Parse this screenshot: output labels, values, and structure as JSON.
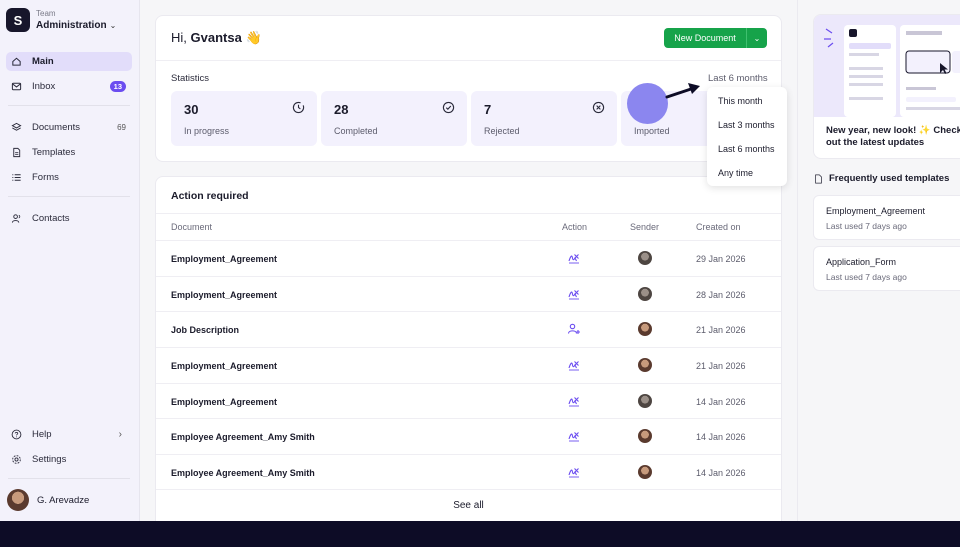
{
  "sidebar": {
    "team_label": "Team",
    "team_name": "Administration",
    "team_logo": "S",
    "items": [
      {
        "label": "Main",
        "icon": "home-icon"
      },
      {
        "label": "Inbox",
        "icon": "mail-icon",
        "badge": "13"
      },
      {
        "label": "Documents",
        "icon": "layers-icon",
        "count": "69"
      },
      {
        "label": "Templates",
        "icon": "file-icon"
      },
      {
        "label": "Forms",
        "icon": "list-icon"
      },
      {
        "label": "Contacts",
        "icon": "users-icon"
      }
    ],
    "help": "Help",
    "settings": "Settings",
    "user_name": "G. Arevadze"
  },
  "header": {
    "greeting": "Hi,",
    "name": "Gvantsa",
    "emoji": "👋",
    "new_document": "New Document"
  },
  "stats": {
    "title": "Statistics",
    "range": "Last 6 months",
    "cards": [
      {
        "value": "30",
        "label": "In progress",
        "icon": "clock-icon"
      },
      {
        "value": "28",
        "label": "Completed",
        "icon": "check-circle-icon"
      },
      {
        "value": "7",
        "label": "Rejected",
        "icon": "x-circle-icon"
      },
      {
        "value": "",
        "label": "Imported",
        "icon": "import-icon"
      }
    ],
    "dropdown": [
      "This month",
      "Last 3 months",
      "Last 6 months",
      "Any time"
    ]
  },
  "actions": {
    "title": "Action required",
    "columns": [
      "Document",
      "Action",
      "Sender",
      "Created on"
    ],
    "rows": [
      {
        "document": "Employment_Agreement",
        "action": "sign-icon",
        "date": "29 Jan 2026"
      },
      {
        "document": "Employment_Agreement",
        "action": "sign-icon",
        "date": "28 Jan 2026"
      },
      {
        "document": "Job Description",
        "action": "assign-user-icon",
        "date": "21 Jan 2026"
      },
      {
        "document": "Employment_Agreement",
        "action": "sign-icon",
        "date": "21 Jan 2026"
      },
      {
        "document": "Employment_Agreement",
        "action": "sign-icon",
        "date": "14 Jan 2026"
      },
      {
        "document": "Employee Agreement_Amy Smith",
        "action": "sign-icon",
        "date": "14 Jan 2026"
      },
      {
        "document": "Employee Agreement_Amy Smith",
        "action": "sign-icon",
        "date": "14 Jan 2026"
      }
    ],
    "see_all": "See all"
  },
  "right": {
    "promo_text": "New year, new look! ✨ Check out the latest updates",
    "frequent_title": "Frequently used templates",
    "templates": [
      {
        "name": "Employment_Agreement",
        "sub": "Last used 7 days ago"
      },
      {
        "name": "Application_Form",
        "sub": "Last used 7 days ago"
      }
    ]
  },
  "colors": {
    "accent": "#6b4df0",
    "primary_button": "#16a34a",
    "stat_bg": "#f3f1fd"
  }
}
